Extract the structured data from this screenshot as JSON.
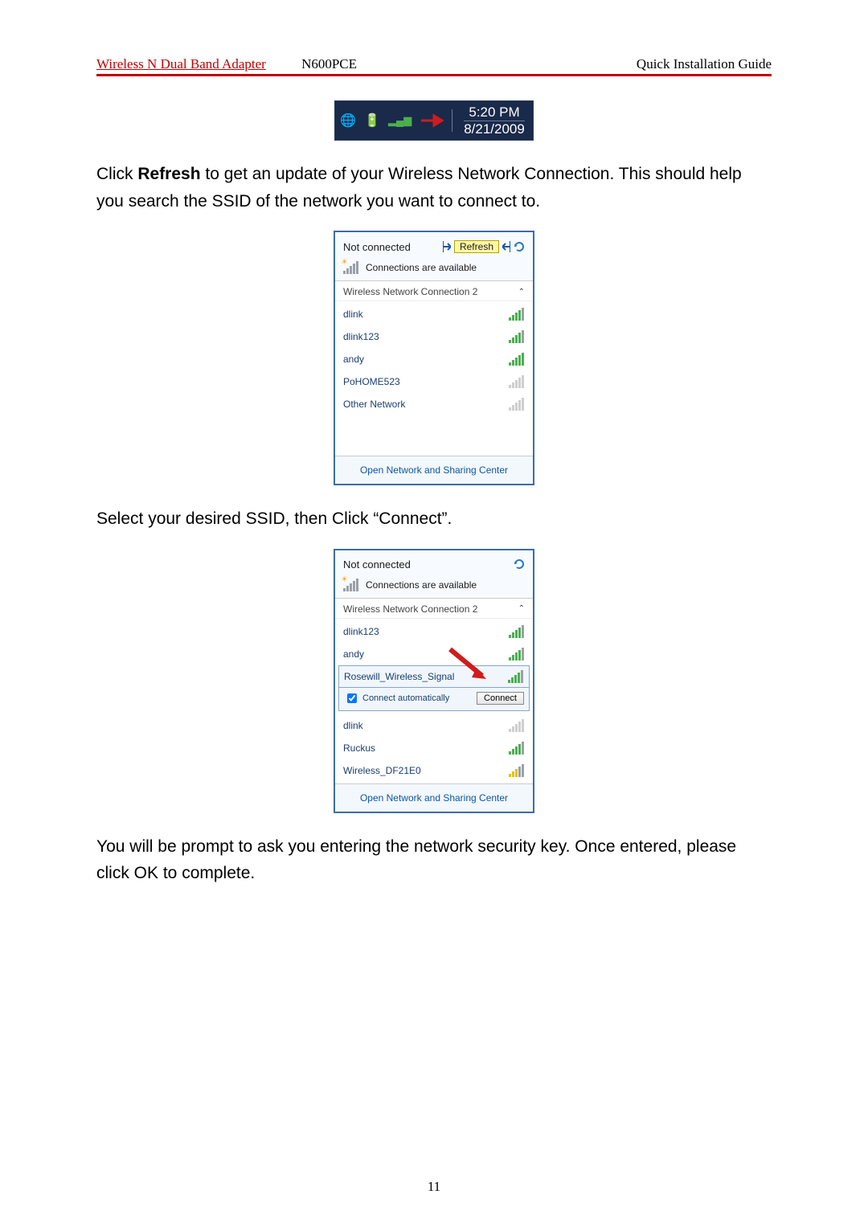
{
  "header": {
    "product": "Wireless N Dual Band Adapter",
    "model": "N600PCE",
    "doc_title": "Quick Installation Guide"
  },
  "tray": {
    "time": "5:20 PM",
    "date": "8/21/2009"
  },
  "para1_a": "Click ",
  "para1_b": "Refresh",
  "para1_c": " to get an update of your Wireless Network Connection. This should help you search the SSID of the network you want to connect to.",
  "flyout1": {
    "status": "Not connected",
    "refresh": "Refresh",
    "avail": "Connections are available",
    "section": "Wireless Network Connection 2",
    "networks": [
      "dlink",
      "dlink123",
      "andy",
      "PoHOME523",
      "Other Network"
    ],
    "footer": "Open Network and Sharing Center"
  },
  "para2": "Select your desired SSID, then Click “Connect”.",
  "flyout2": {
    "status": "Not connected",
    "avail": "Connections are available",
    "section": "Wireless Network Connection 2",
    "networks_top": [
      "dlink123",
      "andy"
    ],
    "selected": "Rosewill_Wireless_Signal",
    "auto_label": "Connect automatically",
    "connect_btn": "Connect",
    "networks_bottom": [
      "dlink",
      "Ruckus",
      "Wireless_DF21E0"
    ],
    "footer": "Open Network and Sharing Center"
  },
  "para3": "You will be prompt to ask you entering the network security key. Once entered, please click OK to complete.",
  "page_number": "11"
}
